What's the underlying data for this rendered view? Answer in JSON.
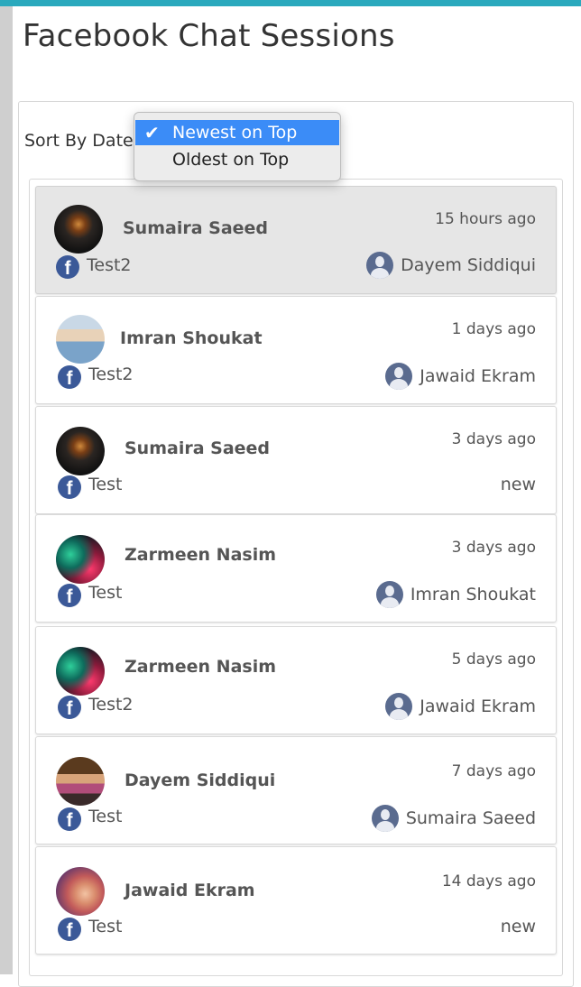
{
  "page": {
    "title": "Facebook Chat Sessions"
  },
  "sort": {
    "label": "Sort By Date",
    "options": [
      {
        "label": "Newest on Top",
        "selected": true
      },
      {
        "label": "Oldest on Top",
        "selected": false
      }
    ],
    "check_glyph": "✔"
  },
  "sessions": [
    {
      "customer": "Sumaira Saeed",
      "time": "15 hours ago",
      "page": "Test2",
      "agent": "Dayem Siddiqui",
      "active": true
    },
    {
      "customer": "Imran Shoukat",
      "time": "1 days ago",
      "page": "Test2",
      "agent": "Jawaid Ekram",
      "active": false
    },
    {
      "customer": "Sumaira Saeed",
      "time": "3 days ago",
      "page": "Test",
      "status": "new",
      "active": false
    },
    {
      "customer": "Zarmeen Nasim",
      "time": "3 days ago",
      "page": "Test",
      "agent": "Imran Shoukat",
      "active": false
    },
    {
      "customer": "Zarmeen Nasim",
      "time": "5 days ago",
      "page": "Test2",
      "agent": "Jawaid Ekram",
      "active": false
    },
    {
      "customer": "Dayem Siddiqui",
      "time": "7 days ago",
      "page": "Test",
      "agent": "Sumaira Saeed",
      "active": false
    },
    {
      "customer": "Jawaid Ekram",
      "time": "14 days ago",
      "page": "Test",
      "status": "new",
      "active": false
    }
  ],
  "icons": {
    "facebook": "facebook-icon",
    "agent": "user-avatar-icon"
  },
  "colors": {
    "accent": "#2aa9bd",
    "selected": "#3b8cf7",
    "facebook": "#3b5998"
  }
}
